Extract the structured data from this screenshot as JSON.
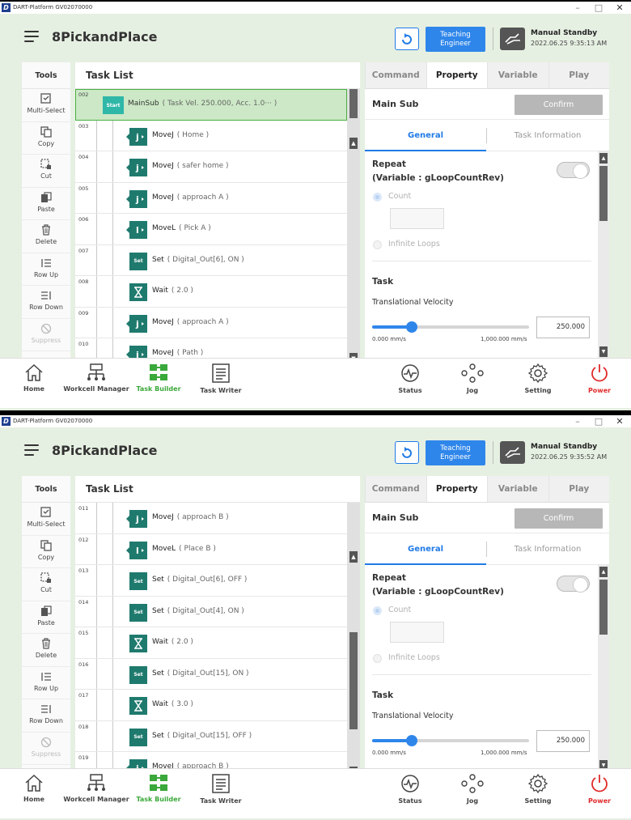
{
  "window_title": "DART-Platform GV02070000",
  "app_title": "8PickandPlace",
  "teaching": {
    "line1": "Teaching",
    "line2": "Engineer"
  },
  "robot_status": "Manual Standby",
  "tools": {
    "title": "Tools",
    "items": [
      {
        "label": "Multi-Select",
        "icon": "multi-select-icon",
        "enabled": true
      },
      {
        "label": "Copy",
        "icon": "copy-icon",
        "enabled": true
      },
      {
        "label": "Cut",
        "icon": "cut-icon",
        "enabled": true
      },
      {
        "label": "Paste",
        "icon": "paste-icon",
        "enabled": true
      },
      {
        "label": "Delete",
        "icon": "delete-icon",
        "enabled": true
      },
      {
        "label": "Row Up",
        "icon": "row-up-icon",
        "enabled": true
      },
      {
        "label": "Row Down",
        "icon": "row-down-icon",
        "enabled": true
      },
      {
        "label": "Suppress",
        "icon": "suppress-icon",
        "enabled": false
      }
    ]
  },
  "task_list_title": "Task List",
  "right_tabs": [
    "Command",
    "Property",
    "Variable",
    "Play"
  ],
  "active_right_tab": "Property",
  "property": {
    "section_title": "Main Sub",
    "confirm_label": "Confirm",
    "subtabs": [
      "General",
      "Task Information"
    ],
    "repeat_line1": "Repeat",
    "repeat_line2": "(Variable : gLoopCountRev)",
    "count_label": "Count",
    "infinite_label": "Infinite Loops",
    "task_title": "Task",
    "trans_vel_label": "Translational Velocity",
    "slider_min": "0.000 mm/s",
    "slider_max": "1,000.000 mm/s",
    "velocity_value": "250.000",
    "slider_fraction": 0.25
  },
  "bottom_nav": [
    {
      "label": "Home",
      "icon": "home-icon"
    },
    {
      "label": "Workcell Manager",
      "icon": "workcell-manager-icon"
    },
    {
      "label": "Task Builder",
      "icon": "task-builder-icon",
      "active": true
    },
    {
      "label": "Task Writer",
      "icon": "task-writer-icon"
    },
    {
      "label": "Status",
      "icon": "status-icon"
    },
    {
      "label": "Jog",
      "icon": "jog-icon"
    },
    {
      "label": "Setting",
      "icon": "setting-icon"
    },
    {
      "label": "Power",
      "icon": "power-icon"
    }
  ],
  "screens": [
    {
      "timestamp": "2022.06.25 9:35:13 AM",
      "rows": [
        {
          "num": "002",
          "type": "Start",
          "cmd": "MainSub",
          "arg": "( Task Vel. 250.000, Acc. 1.0··· )",
          "selected": true
        },
        {
          "num": "003",
          "type": "J",
          "cmd": "MoveJ",
          "arg": "( Home )"
        },
        {
          "num": "004",
          "type": "J",
          "cmd": "MoveJ",
          "arg": "( safer home )"
        },
        {
          "num": "005",
          "type": "J",
          "cmd": "MoveJ",
          "arg": "( approach A )"
        },
        {
          "num": "006",
          "type": "L",
          "cmd": "MoveL",
          "arg": "( Pick A )"
        },
        {
          "num": "007",
          "type": "Set",
          "cmd": "Set",
          "arg": "( Digital_Out[6], ON )"
        },
        {
          "num": "008",
          "type": "Wait",
          "cmd": "Wait",
          "arg": "( 2.0 )"
        },
        {
          "num": "009",
          "type": "J",
          "cmd": "MoveJ",
          "arg": "( approach A )"
        },
        {
          "num": "010",
          "type": "J",
          "cmd": "MoveJ",
          "arg": "( Path )"
        }
      ]
    },
    {
      "timestamp": "2022.06.25 9:35:52 AM",
      "rows": [
        {
          "num": "011",
          "type": "J",
          "cmd": "MoveJ",
          "arg": "( approach B )"
        },
        {
          "num": "012",
          "type": "L",
          "cmd": "MoveL",
          "arg": "( Place B )"
        },
        {
          "num": "013",
          "type": "Set",
          "cmd": "Set",
          "arg": "( Digital_Out[6], OFF )"
        },
        {
          "num": "014",
          "type": "Set",
          "cmd": "Set",
          "arg": "( Digital_Out[4], ON )"
        },
        {
          "num": "015",
          "type": "Wait",
          "cmd": "Wait",
          "arg": "( 2.0 )"
        },
        {
          "num": "016",
          "type": "Set",
          "cmd": "Set",
          "arg": "( Digital_Out[15], ON )"
        },
        {
          "num": "017",
          "type": "Wait",
          "cmd": "Wait",
          "arg": "( 3.0 )"
        },
        {
          "num": "018",
          "type": "Set",
          "cmd": "Set",
          "arg": "( Digital_Out[15], OFF )"
        },
        {
          "num": "019",
          "type": "J",
          "cmd": "MoveJ",
          "arg": "( approach B )"
        }
      ]
    }
  ],
  "colors": {
    "accent": "#2f86ea",
    "selection": "#cce8c6",
    "active_nav": "#3aa83a",
    "power": "#e02a2a",
    "badge": "#1f7a6e"
  }
}
